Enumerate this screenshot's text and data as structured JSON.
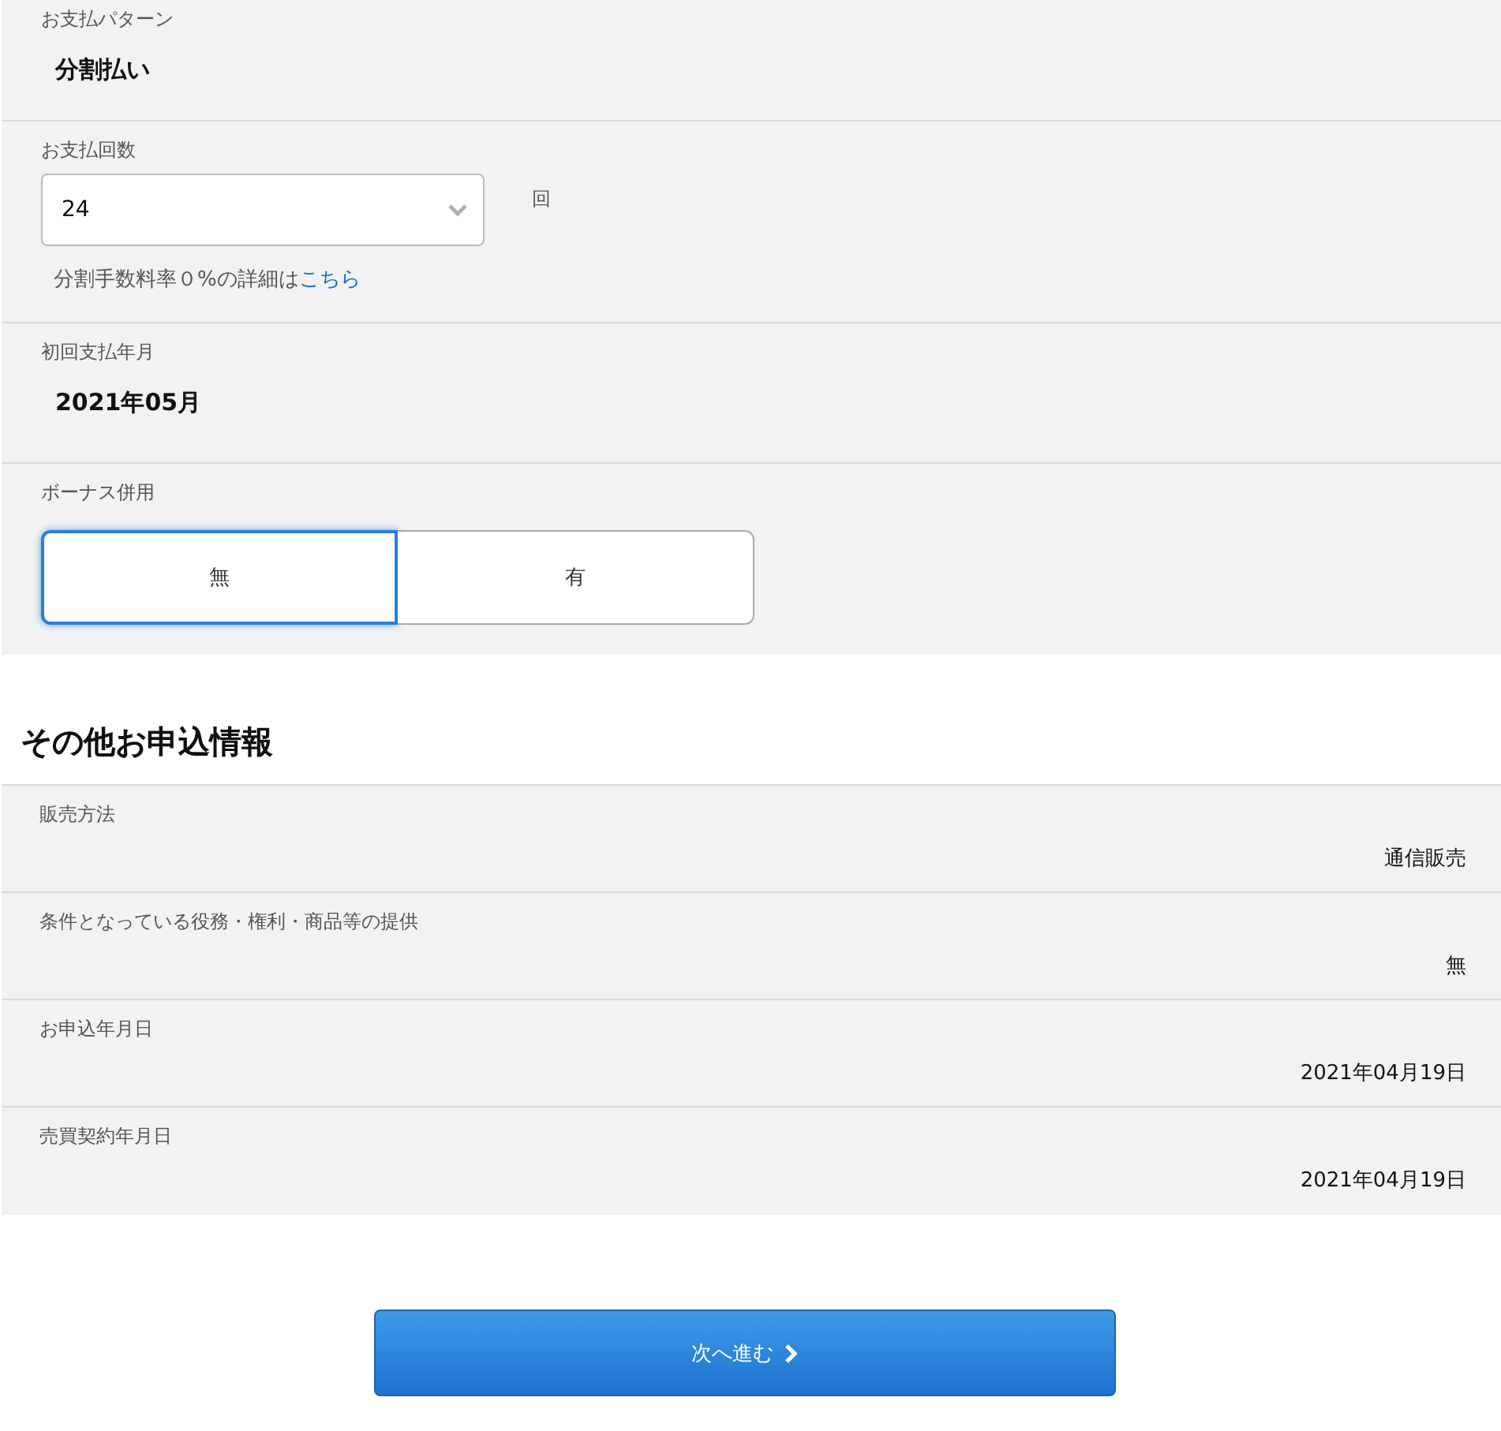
{
  "payment_sections": [
    {
      "kind": "text",
      "label": "お支払パターン",
      "value": "分割払い"
    },
    {
      "kind": "select",
      "label": "お支払回数",
      "value": "24",
      "unit": "回",
      "note": "分割手数料率０%の詳細は",
      "note_link": "こちら"
    },
    {
      "kind": "text",
      "label": "初回支払年月",
      "value": "2021年05月"
    },
    {
      "kind": "toggle",
      "label": "ボーナス併用",
      "options": [
        {
          "label": "無",
          "selected": true
        },
        {
          "label": "有",
          "selected": false
        }
      ]
    }
  ],
  "other_info": {
    "heading": "その他お申込情報",
    "rows": [
      {
        "label": "販売方法",
        "value": "通信販売"
      },
      {
        "label": "条件となっている役務・権利・商品等の提供",
        "value": "無"
      },
      {
        "label": "お申込年月日",
        "value": "2021年04月19日"
      },
      {
        "label": "売買契約年月日",
        "value": "2021年04月19日"
      }
    ]
  },
  "next_button": {
    "label": "次へ進む"
  }
}
